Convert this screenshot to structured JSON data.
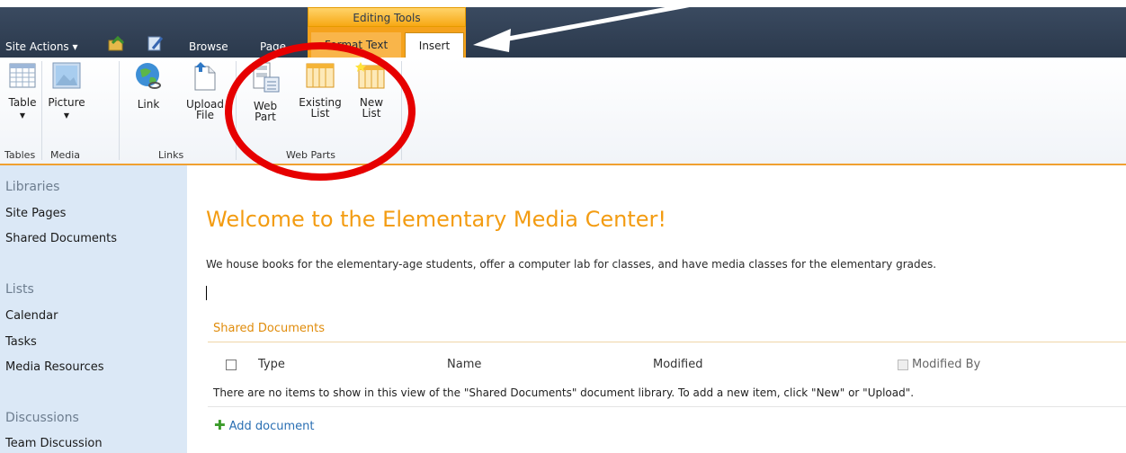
{
  "topbar": {
    "site_actions": "Site Actions ▾",
    "browse": "Browse",
    "page": "Page"
  },
  "contextual": {
    "header": "Editing Tools",
    "tab_format": "Format Text",
    "tab_insert": "Insert"
  },
  "ribbon": {
    "table": "Table",
    "picture": "Picture",
    "link": "Link",
    "upload_l1": "Upload",
    "upload_l2": "File",
    "webpart_l1": "Web",
    "webpart_l2": "Part",
    "existing_l1": "Existing",
    "existing_l2": "List",
    "newlist_l1": "New",
    "newlist_l2": "List",
    "groups": {
      "tables": "Tables",
      "media": "Media",
      "links": "Links",
      "webparts": "Web Parts"
    }
  },
  "sidebar": {
    "libraries": "Libraries",
    "site_pages": "Site Pages",
    "shared_documents": "Shared Documents",
    "lists": "Lists",
    "calendar": "Calendar",
    "tasks": "Tasks",
    "media_resources": "Media Resources",
    "discussions": "Discussions",
    "team_discussion": "Team Discussion"
  },
  "main": {
    "title": "Welcome to the Elementary Media Center!",
    "description": "We house books for the elementary-age students, offer a computer lab for classes, and have media classes for the elementary grades.",
    "webpart_title": "Shared Documents",
    "columns": {
      "type": "Type",
      "name": "Name",
      "modified": "Modified",
      "modified_by": "Modified By"
    },
    "empty_message": "There are no items to show in this view of the \"Shared Documents\" document library. To add a new item, click \"New\" or \"Upload\".",
    "add_document": "Add document"
  },
  "colors": {
    "accent": "#f39c12",
    "annotation_red": "#e60000",
    "annotation_arrow": "#ffffff"
  }
}
